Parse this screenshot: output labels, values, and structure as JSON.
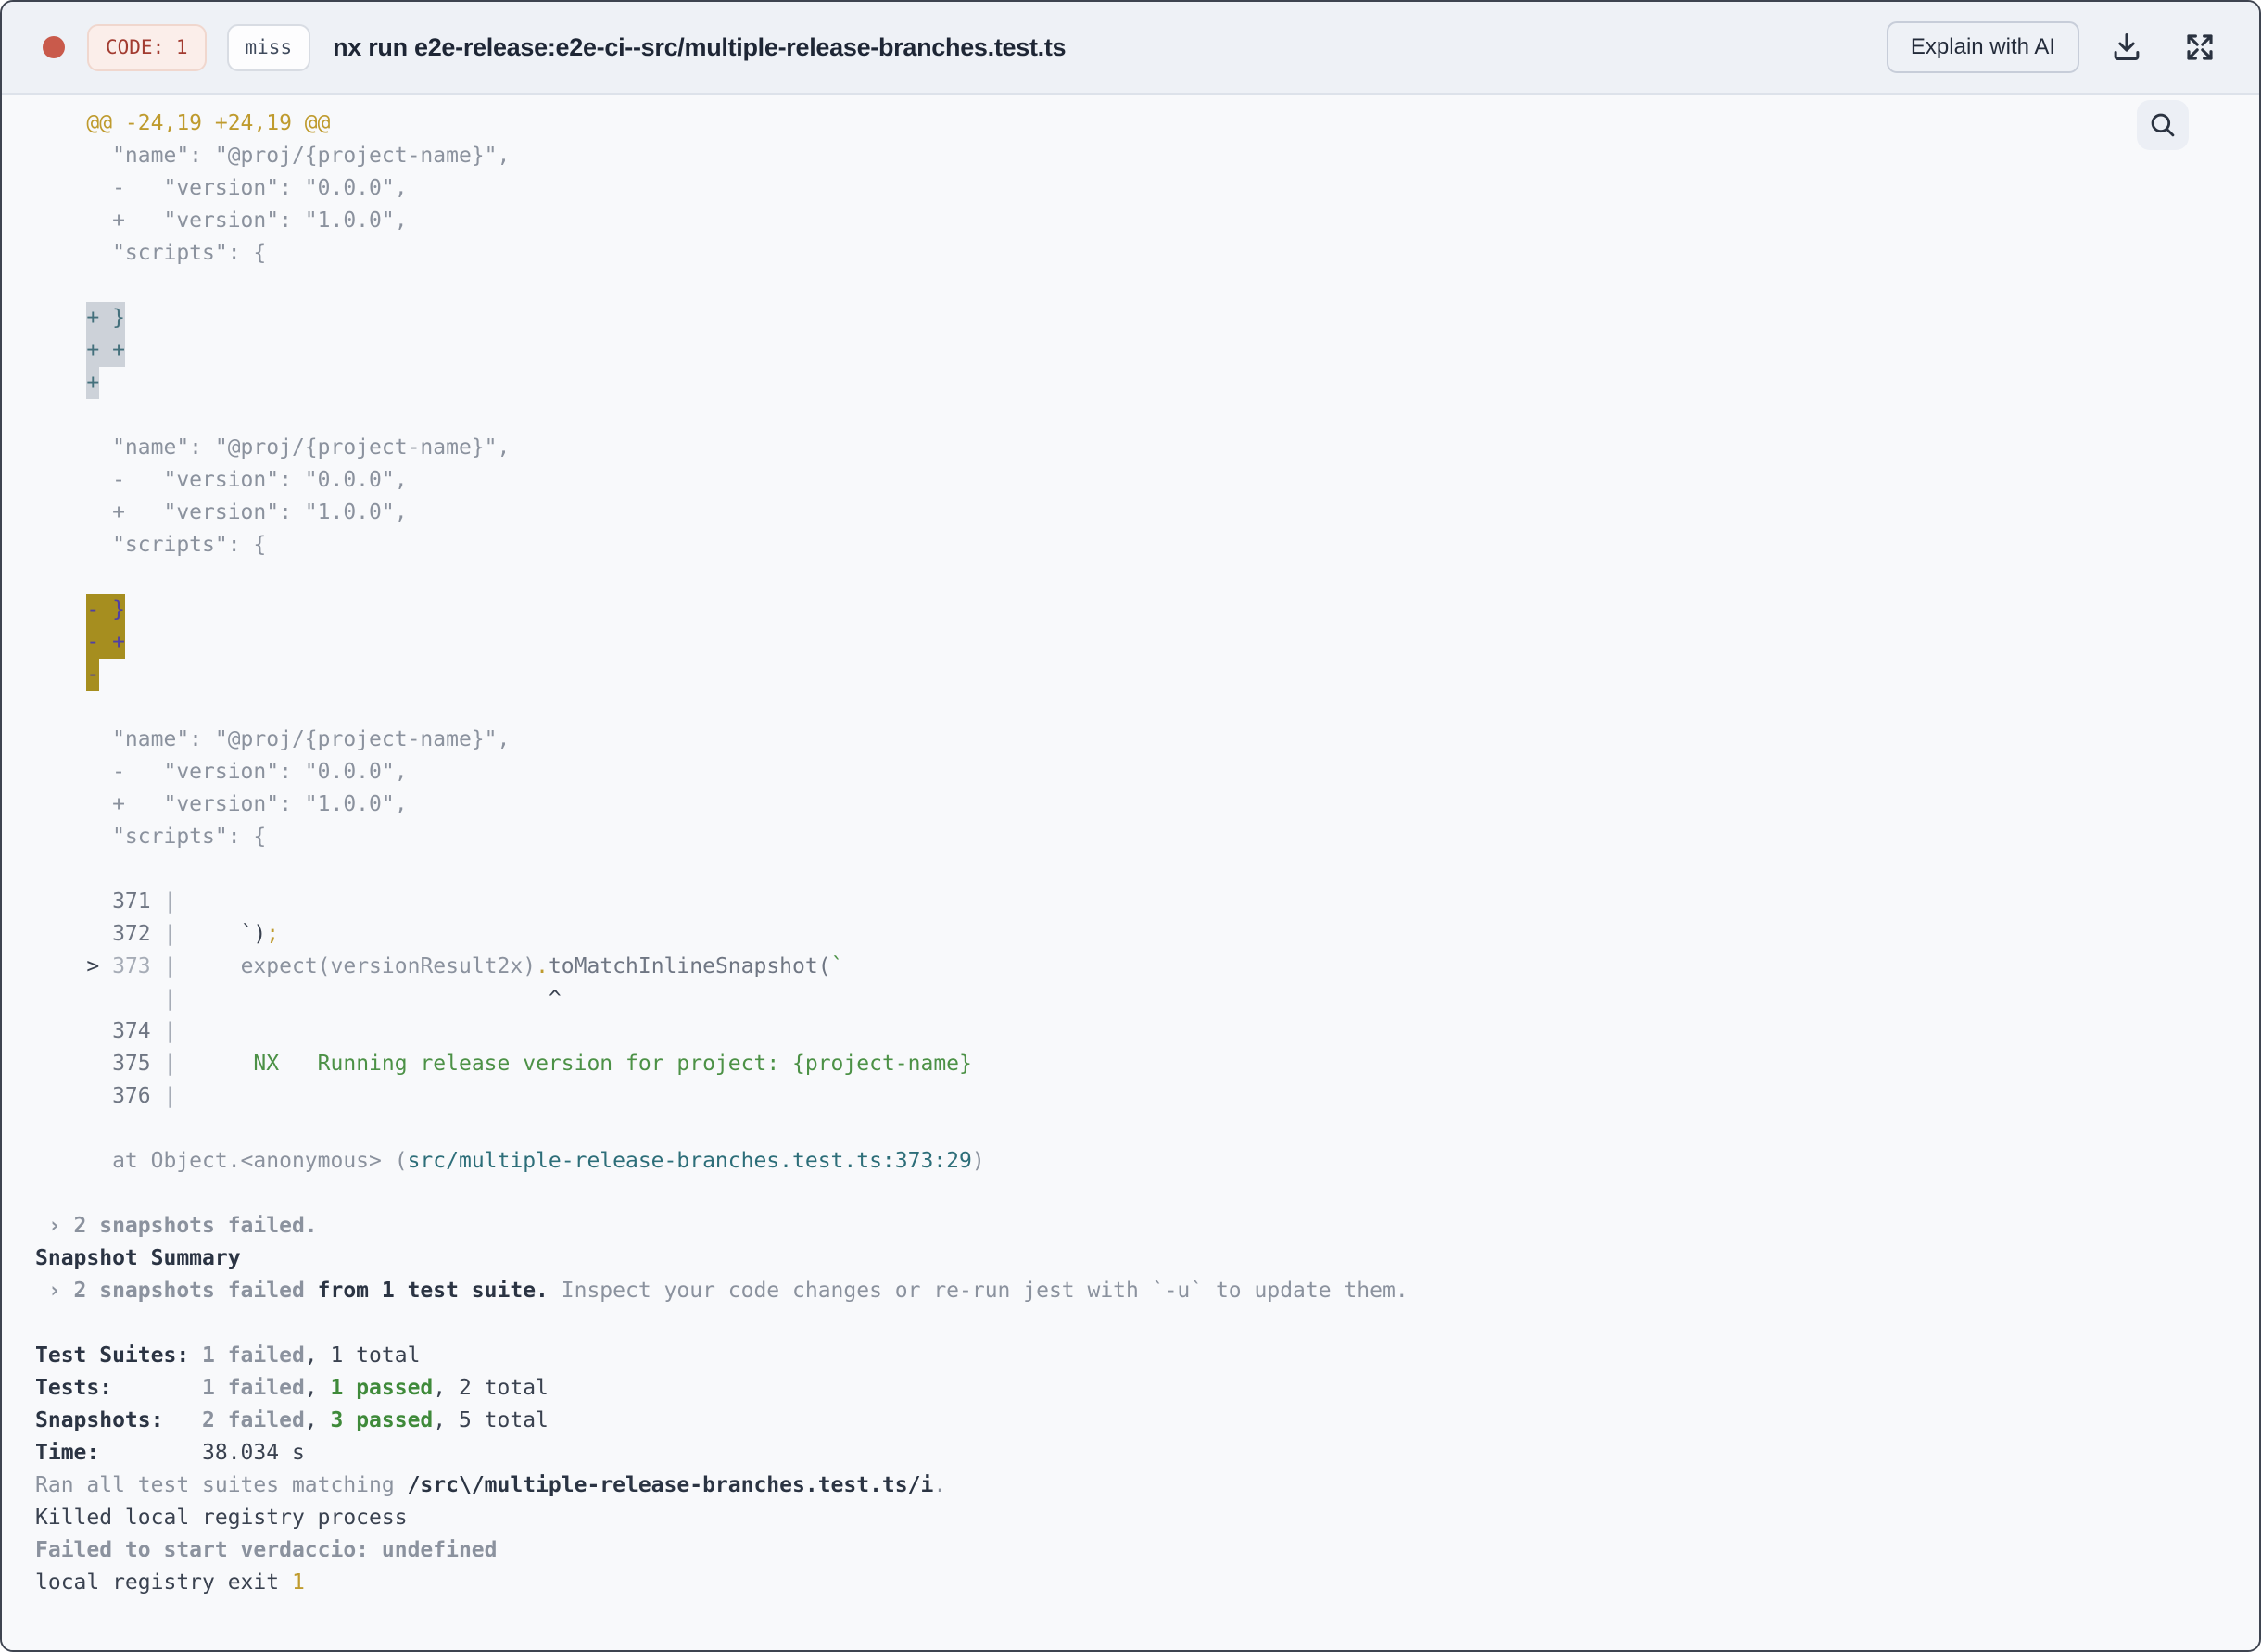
{
  "header": {
    "code_badge": "CODE: 1",
    "cache_badge": "miss",
    "title": "nx run e2e-release:e2e-ci--src/multiple-release-branches.test.ts",
    "explain_button": "Explain with AI"
  },
  "icons": [
    "status-dot",
    "download-icon",
    "expand-icon",
    "search-icon"
  ],
  "colors": {
    "status_dot": "#c95a4b",
    "code_badge_text": "#a23b30",
    "header_bg": "#eef1f6",
    "terminal_bg": "#f8f9fb",
    "diff_hunk_yellow": "#bf9b2e",
    "diff_text_gray": "#8b929e",
    "success_green": "#3f8a3a",
    "file_link_teal": "#2d6e79",
    "match_highlight_bg": "#cdd2d9",
    "match_highlight_text": "#44707c",
    "active_match_bg": "#a68e1f",
    "active_match_text": "#4f3fa5"
  },
  "terminal": {
    "lines": [
      [
        [
          "y",
          "    @@ -24,19 +24,19 @@"
        ]
      ],
      [
        [
          "g",
          "      \"name\": \"@proj/{project-name}\","
        ]
      ],
      [
        [
          "g",
          "      -   \"version\": \"0.0.0\","
        ]
      ],
      [
        [
          "g",
          "      +   \"version\": \"1.0.0\","
        ]
      ],
      [
        [
          "g",
          "      \"scripts\": {"
        ]
      ],
      [],
      [
        [
          "g",
          "    "
        ],
        [
          "hl1",
          "+ }"
        ]
      ],
      [
        [
          "g",
          "    "
        ],
        [
          "hl1",
          "+ +"
        ]
      ],
      [
        [
          "g",
          "    "
        ],
        [
          "hl1",
          "+"
        ]
      ],
      [],
      [
        [
          "g",
          "      \"name\": \"@proj/{project-name}\","
        ]
      ],
      [
        [
          "g",
          "      -   \"version\": \"0.0.0\","
        ]
      ],
      [
        [
          "g",
          "      +   \"version\": \"1.0.0\","
        ]
      ],
      [
        [
          "g",
          "      \"scripts\": {"
        ]
      ],
      [],
      [
        [
          "g",
          "    "
        ],
        [
          "hl2",
          "- }"
        ]
      ],
      [
        [
          "g",
          "    "
        ],
        [
          "hl2",
          "- +"
        ]
      ],
      [
        [
          "g",
          "    "
        ],
        [
          "hl2",
          "-"
        ]
      ],
      [],
      [
        [
          "g",
          "      \"name\": \"@proj/{project-name}\","
        ]
      ],
      [
        [
          "g",
          "      -   \"version\": \"0.0.0\","
        ]
      ],
      [
        [
          "g",
          "      +   \"version\": \"1.0.0\","
        ]
      ],
      [
        [
          "g",
          "      \"scripts\": {"
        ]
      ],
      [],
      [
        [
          "ln",
          "      371 "
        ],
        [
          "p",
          "|"
        ]
      ],
      [
        [
          "ln",
          "      372 "
        ],
        [
          "p",
          "|"
        ],
        [
          "d",
          "     `)"
        ],
        [
          "y",
          ";"
        ]
      ],
      [
        [
          "d",
          "    > "
        ],
        [
          "lnf",
          "373 "
        ],
        [
          "p",
          "|"
        ],
        [
          "g",
          "     expect(versionResult2x)"
        ],
        [
          "y",
          "."
        ],
        [
          "d2",
          "toMatchInlineSnapshot("
        ],
        [
          "grn",
          "`"
        ]
      ],
      [
        [
          "g",
          "          "
        ],
        [
          "p",
          "|"
        ],
        [
          "d",
          "                             ^"
        ]
      ],
      [
        [
          "ln",
          "      374 "
        ],
        [
          "p",
          "|"
        ]
      ],
      [
        [
          "ln",
          "      375 "
        ],
        [
          "p",
          "|"
        ],
        [
          "grn",
          "      NX   Running release version for project: {project-name}"
        ]
      ],
      [
        [
          "ln",
          "      376 "
        ],
        [
          "p",
          "|"
        ]
      ],
      [],
      [
        [
          "g",
          "      at Object.<anonymous> ("
        ],
        [
          "teal",
          "src/multiple-release-branches.test.ts:373:29"
        ],
        [
          "g",
          ")"
        ]
      ],
      [],
      [
        [
          "gb",
          " › 2 snapshots failed."
        ]
      ],
      [
        [
          "db",
          "Snapshot Summary"
        ]
      ],
      [
        [
          "gb",
          " › 2 snapshots failed"
        ],
        [
          "db",
          " from 1 test suite."
        ],
        [
          "g",
          " Inspect your code changes or re-run jest with `-u` to update them."
        ]
      ],
      [],
      [
        [
          "db",
          "Test Suites: "
        ],
        [
          "gb",
          "1 failed"
        ],
        [
          "d",
          ", 1 total"
        ]
      ],
      [
        [
          "db",
          "Tests:       "
        ],
        [
          "gb",
          "1 failed"
        ],
        [
          "d",
          ", "
        ],
        [
          "grnb",
          "1 passed"
        ],
        [
          "d",
          ", 2 total"
        ]
      ],
      [
        [
          "db",
          "Snapshots:   "
        ],
        [
          "gb",
          "2 failed"
        ],
        [
          "d",
          ", "
        ],
        [
          "grnb",
          "3 passed"
        ],
        [
          "d",
          ", 5 total"
        ]
      ],
      [
        [
          "db",
          "Time:        "
        ],
        [
          "d",
          "38.034 s"
        ]
      ],
      [
        [
          "g",
          "Ran all test suites matching "
        ],
        [
          "db",
          "/src\\/multiple-release-branches.test.ts/i"
        ],
        [
          "g",
          "."
        ]
      ],
      [
        [
          "d",
          "Killed local registry process"
        ]
      ],
      [
        [
          "gb",
          "Failed to start verdaccio: undefined"
        ]
      ],
      [
        [
          "d",
          "local registry exit "
        ],
        [
          "y",
          "1"
        ]
      ]
    ]
  }
}
